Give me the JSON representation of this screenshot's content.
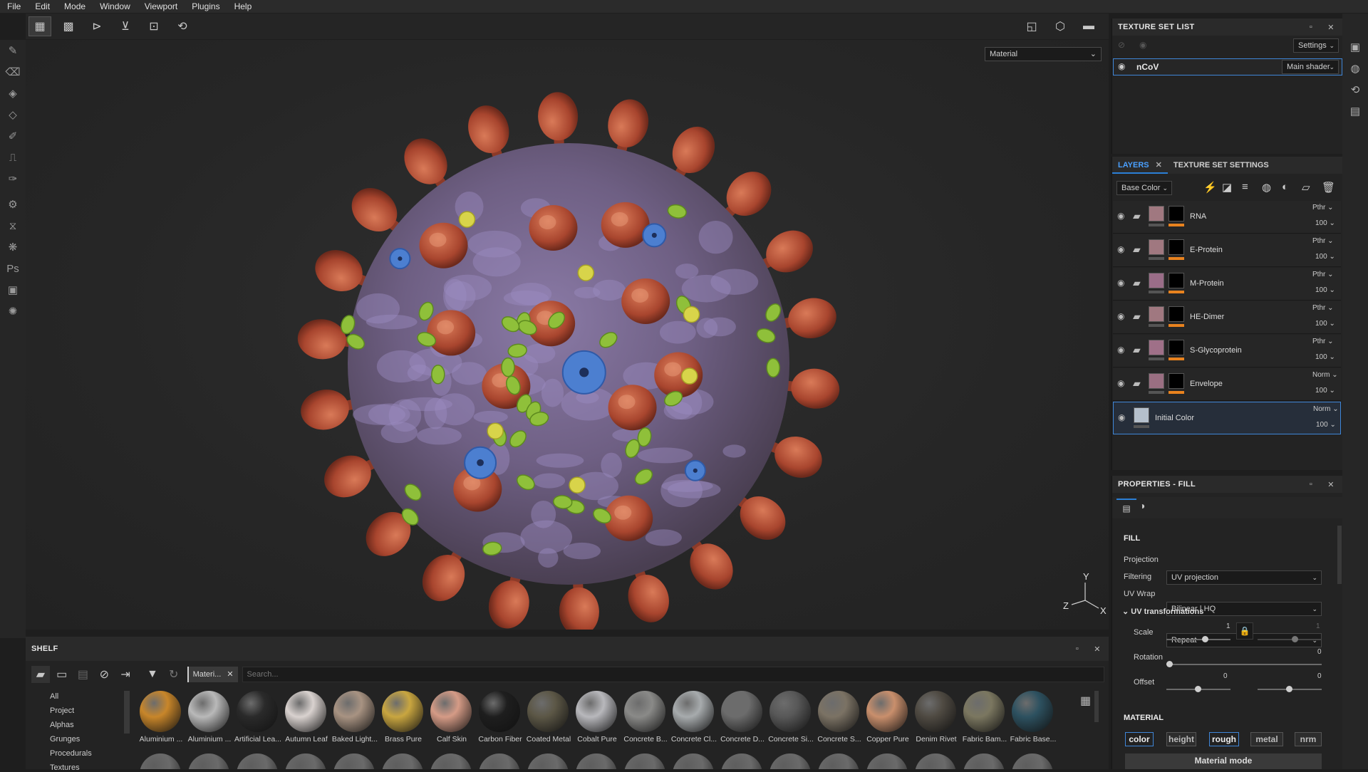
{
  "menu": [
    "File",
    "Edit",
    "Mode",
    "Window",
    "Viewport",
    "Plugins",
    "Help"
  ],
  "viewport": {
    "display_mode": "Material",
    "axis_y": "Y",
    "axis_z": "Z",
    "axis_x": "X"
  },
  "texture_set_list": {
    "title": "TEXTURE SET LIST",
    "settings_label": "Settings",
    "set_name": "nCoV",
    "shader": "Main shader"
  },
  "layers_panel": {
    "tab_layers": "LAYERS",
    "tab_texture_set_settings": "TEXTURE SET SETTINGS",
    "channel": "Base Color",
    "layers": [
      {
        "name": "RNA",
        "blend": "Pthr",
        "opacity": "100"
      },
      {
        "name": "E-Protein",
        "blend": "Pthr",
        "opacity": "100"
      },
      {
        "name": "M-Protein",
        "blend": "Pthr",
        "opacity": "100"
      },
      {
        "name": "HE-Dimer",
        "blend": "Pthr",
        "opacity": "100"
      },
      {
        "name": "S-Glycoprotein",
        "blend": "Pthr",
        "opacity": "100"
      },
      {
        "name": "Envelope",
        "blend": "Norm",
        "opacity": "100"
      },
      {
        "name": "Initial Color",
        "blend": "Norm",
        "opacity": "100"
      }
    ]
  },
  "properties": {
    "title": "PROPERTIES - FILL",
    "fill_heading": "FILL",
    "projection_label": "Projection",
    "projection_value": "UV projection",
    "filtering_label": "Filtering",
    "filtering_value": "Bilinear | HQ",
    "uvwrap_label": "UV Wrap",
    "uvwrap_value": "Repeat",
    "uv_transform_heading": "UV transformations",
    "scale_label": "Scale",
    "scale_value": "1",
    "scale_value_2": "1",
    "rotation_label": "Rotation",
    "rotation_value": "0",
    "offset_label": "Offset",
    "offset_x": "0",
    "offset_y": "0",
    "material_heading": "MATERIAL",
    "channels": [
      "color",
      "height",
      "rough",
      "metal",
      "nrm"
    ],
    "material_mode": "Material mode"
  },
  "shelf": {
    "title": "SHELF",
    "filter_tag": "Materi...",
    "search_placeholder": "Search...",
    "categories": [
      "All",
      "Project",
      "Alphas",
      "Grunges",
      "Procedurals",
      "Textures"
    ],
    "materials": [
      {
        "name": "Aluminium ...",
        "color": "#c8862a"
      },
      {
        "name": "Aluminium ...",
        "color": "#b9b9b9"
      },
      {
        "name": "Artificial Lea...",
        "color": "#2a2a2a"
      },
      {
        "name": "Autumn Leaf",
        "color": "#d9d2cf"
      },
      {
        "name": "Baked Light...",
        "color": "#a89382"
      },
      {
        "name": "Brass Pure",
        "color": "#c9a640"
      },
      {
        "name": "Calf Skin",
        "color": "#d59b86"
      },
      {
        "name": "Carbon Fiber",
        "color": "#1e1e1e"
      },
      {
        "name": "Coated Metal",
        "color": "#5c5746"
      },
      {
        "name": "Cobalt Pure",
        "color": "#b8b8bc"
      },
      {
        "name": "Concrete B...",
        "color": "#8a8a88"
      },
      {
        "name": "Concrete Cl...",
        "color": "#a7abad"
      },
      {
        "name": "Concrete D...",
        "color": "#6c6c6c"
      },
      {
        "name": "Concrete Si...",
        "color": "#585858"
      },
      {
        "name": "Concrete S...",
        "color": "#7b7264"
      },
      {
        "name": "Copper Pure",
        "color": "#c98f6c"
      },
      {
        "name": "Denim Rivet",
        "color": "#4f4a42"
      },
      {
        "name": "Fabric Bam...",
        "color": "#7b7760"
      },
      {
        "name": "Fabric Base...",
        "color": "#2d5160"
      }
    ]
  }
}
